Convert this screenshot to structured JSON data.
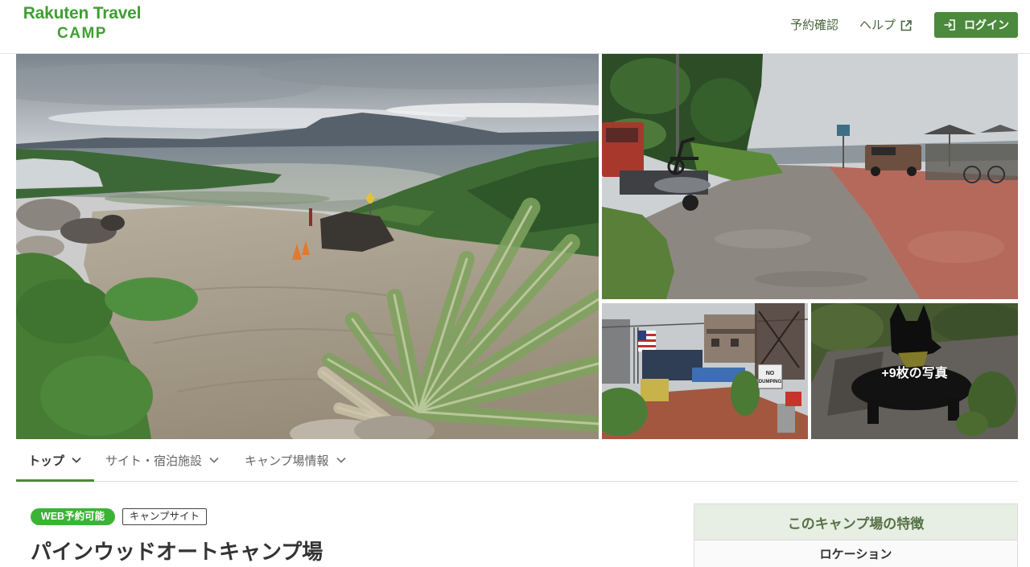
{
  "header": {
    "logo": {
      "line1": "Rakuten Travel",
      "line2": "CAMP"
    },
    "nav": {
      "reservation_check": "予約確認",
      "help": {
        "label": "ヘルプ",
        "icon": "external-link-icon"
      },
      "login": {
        "label": "ログイン",
        "icon": "login-icon"
      }
    }
  },
  "gallery": {
    "more_photos_label": "+9枚の写真",
    "sign_text": [
      "NO",
      "DUMPING"
    ]
  },
  "tabs": [
    {
      "label": "トップ",
      "active": true,
      "icon": "chevron-down-icon"
    },
    {
      "label": "サイト・宿泊施設",
      "active": false,
      "icon": "chevron-down-icon"
    },
    {
      "label": "キャンプ場情報",
      "active": false,
      "icon": "chevron-down-icon"
    }
  ],
  "listing": {
    "badges": {
      "web_booking": "WEB予約可能",
      "category": "キャンプサイト"
    },
    "title": "パインウッドオートキャンプ場"
  },
  "features": {
    "heading": "このキャンプ場の特徴",
    "rows": [
      {
        "label": "ロケーション"
      }
    ]
  },
  "colors": {
    "brand_green": "#3f9f32",
    "button_green": "#4b8a3c",
    "badge_green": "#3bb335",
    "features_header_bg": "#e7eee3",
    "features_heading_text": "#567246",
    "nav_text": "#47663d"
  }
}
